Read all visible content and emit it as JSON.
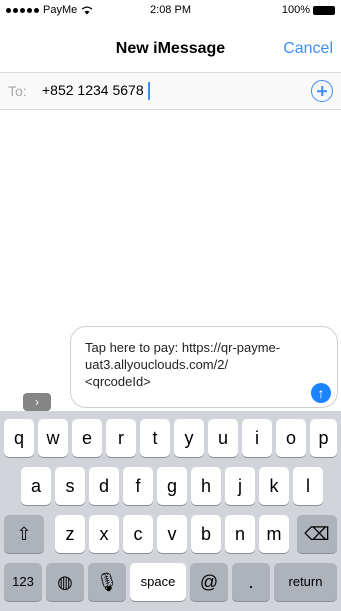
{
  "status_bar": {
    "carrier": "PayMe",
    "time": "2:08 PM",
    "battery": "100%"
  },
  "nav": {
    "title": "New iMessage",
    "cancel": "Cancel"
  },
  "recipient": {
    "label": "To:",
    "value": "+852 1234 5678"
  },
  "message": {
    "text": "Tap here to pay: https://qr-payme-\nuat3.allyouclouds.com/2/\n<qrcodeId>"
  },
  "keyboard": {
    "row1": [
      "q",
      "w",
      "e",
      "r",
      "t",
      "y",
      "u",
      "i",
      "o",
      "p"
    ],
    "row2": [
      "a",
      "s",
      "d",
      "f",
      "g",
      "h",
      "j",
      "k",
      "l"
    ],
    "row3": [
      "z",
      "x",
      "c",
      "v",
      "b",
      "n",
      "m"
    ],
    "numbers": "123",
    "space": "space",
    "at": "@",
    "period": ".",
    "return": "return"
  },
  "icons": {
    "signal": "signal-dots-icon",
    "wifi": "wifi-icon",
    "battery": "battery-icon",
    "add_contact": "add-contact-icon",
    "apps": "app-drawer-icon",
    "send": "send-arrow-icon",
    "shift": "shift-icon",
    "delete": "delete-icon",
    "globe": "globe-icon",
    "mic": "microphone-icon"
  },
  "colors": {
    "accent": "#3c8ef3",
    "send": "#1a84ff",
    "keyboard_bg": "#d1d5db"
  }
}
